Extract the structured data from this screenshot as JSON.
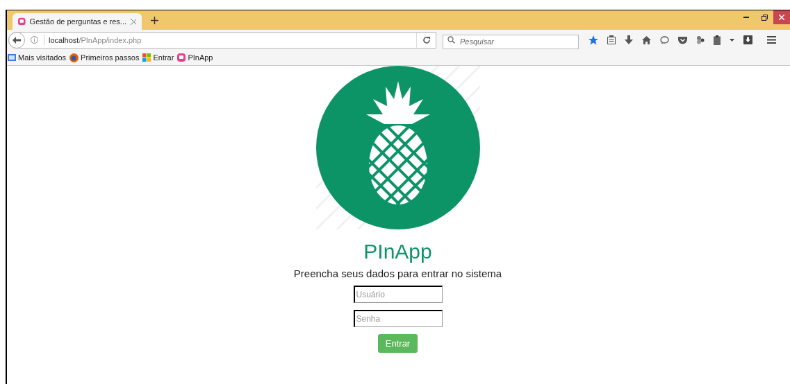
{
  "browser": {
    "tabs": [
      {
        "title": "Gestão de perguntas e res...",
        "selected": true
      }
    ],
    "address": {
      "host": "localhost",
      "path": "/PInApp/index.php"
    },
    "search": {
      "placeholder": "Pesquisar"
    },
    "bookmarks": [
      {
        "label": "Mais visitados",
        "kind": "folder"
      },
      {
        "label": "Primeiros passos",
        "kind": "globe"
      },
      {
        "label": "Entrar",
        "kind": "tiles"
      },
      {
        "label": "PInApp",
        "kind": "app"
      }
    ]
  },
  "page": {
    "app_name": "PInApp",
    "prompt": "Preencha seus dados para entrar no sistema",
    "fields": [
      {
        "placeholder": "Usuário"
      },
      {
        "placeholder": "Senha"
      }
    ],
    "submit": "Entrar"
  }
}
